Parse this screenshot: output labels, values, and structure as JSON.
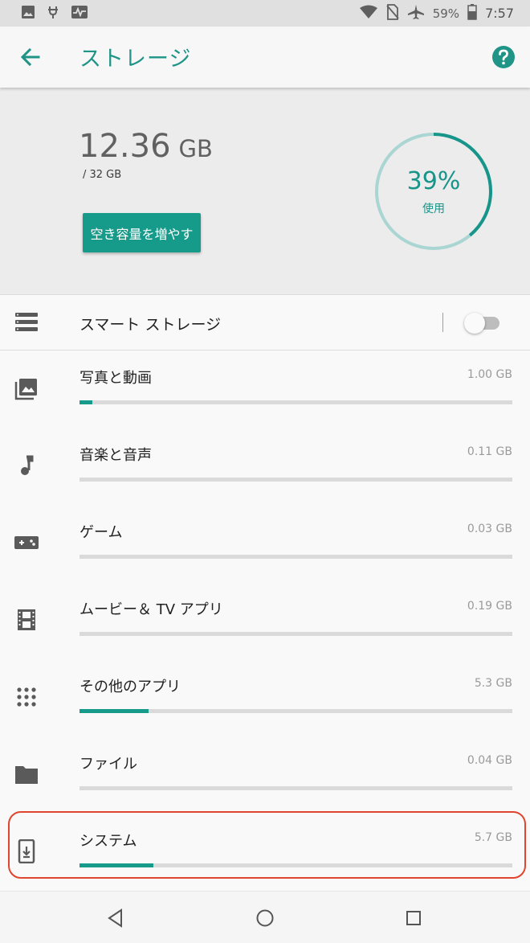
{
  "status_bar": {
    "battery": "59%",
    "time": "7:57",
    "icons": [
      "image-icon",
      "usb-debug-icon",
      "activity-icon",
      "wifi-icon",
      "no-sim-icon",
      "airplane-icon",
      "battery-icon"
    ]
  },
  "app_bar": {
    "title": "ストレージ",
    "back_icon": "arrow-back-icon",
    "help_icon": "help-icon",
    "accent": "#1f9487"
  },
  "summary": {
    "used_value": "12.36",
    "used_unit": "GB",
    "total": "/ 32 GB",
    "free_up_label": "空き容量を増やす",
    "percent_label": "39%",
    "percent_caption": "使用",
    "percent_value": 39
  },
  "smart_storage": {
    "label": "スマート ストレージ",
    "enabled": false
  },
  "categories": [
    {
      "label": "写真と動画",
      "size": "1.00 GB",
      "fraction": 0.03,
      "icon": "photo-icon"
    },
    {
      "label": "音楽と音声",
      "size": "0.11 GB",
      "fraction": 0.0,
      "icon": "music-note-icon"
    },
    {
      "label": "ゲーム",
      "size": "0.03 GB",
      "fraction": 0.0,
      "icon": "gamepad-icon"
    },
    {
      "label": "ムービー＆ TV アプリ",
      "size": "0.19 GB",
      "fraction": 0.0,
      "icon": "movie-icon"
    },
    {
      "label": "その他のアプリ",
      "size": "5.3 GB",
      "fraction": 0.16,
      "icon": "apps-grid-icon"
    },
    {
      "label": "ファイル",
      "size": "0.04 GB",
      "fraction": 0.0,
      "icon": "folder-icon"
    },
    {
      "label": "システム",
      "size": "5.7 GB",
      "fraction": 0.17,
      "icon": "system-update-icon"
    }
  ],
  "colors": {
    "accent": "#169a8a",
    "highlight": "#e0452f"
  },
  "nav_bar": {
    "icons": [
      "nav-back-icon",
      "nav-home-icon",
      "nav-recents-icon"
    ]
  }
}
